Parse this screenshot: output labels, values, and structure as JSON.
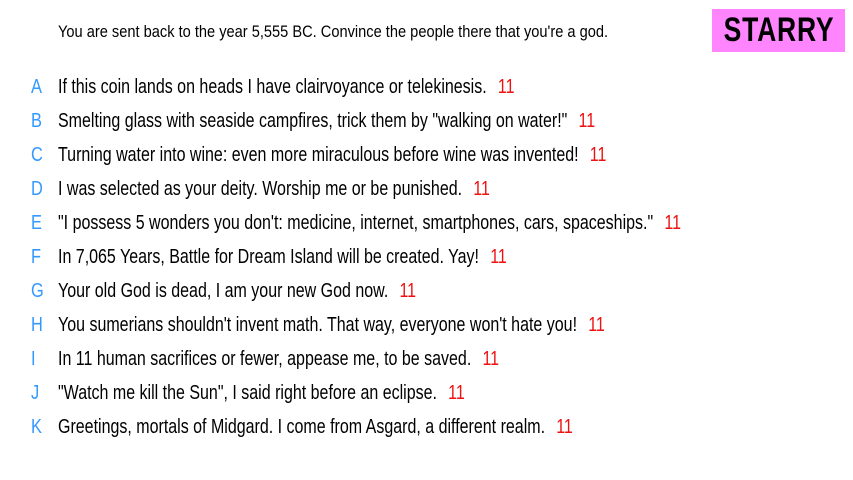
{
  "prompt": "You are sent back to the year 5,555 BC. Convince the people there that you're a god.",
  "badge": "STARRY",
  "colors": {
    "letter": "#3399ff",
    "score": "#ee1111",
    "badge_bg": "#ff85ff"
  },
  "entries": [
    {
      "letter": "A",
      "text": "If this coin lands on heads I have clairvoyance or telekinesis.",
      "score": "11"
    },
    {
      "letter": "B",
      "text": "Smelting glass with seaside campfires, trick them by \"walking on water!\"",
      "score": "11"
    },
    {
      "letter": "C",
      "text": "Turning water into wine: even more miraculous before wine was invented!",
      "score": "11"
    },
    {
      "letter": "D",
      "text": "I was selected as your deity. Worship me or be punished.",
      "score": "11"
    },
    {
      "letter": "E",
      "text": "\"I possess 5 wonders you don't: medicine, internet, smartphones, cars, spaceships.\"",
      "score": "11"
    },
    {
      "letter": "F",
      "text": "In 7,065 Years, Battle for Dream Island will be created. Yay!",
      "score": "11"
    },
    {
      "letter": "G",
      "text": "Your old God is dead, I am your new God now.",
      "score": "11"
    },
    {
      "letter": "H",
      "text": "You sumerians shouldn't invent math. That way, everyone won't hate you!",
      "score": "11"
    },
    {
      "letter": "I",
      "text": "In 11 human sacrifices or fewer, appease me, to be saved.",
      "score": "11"
    },
    {
      "letter": "J",
      "text": "\"Watch me kill the Sun\", I said right before an eclipse.",
      "score": "11"
    },
    {
      "letter": "K",
      "text": "Greetings, mortals of Midgard. I come from Asgard, a different realm.",
      "score": "11"
    }
  ]
}
